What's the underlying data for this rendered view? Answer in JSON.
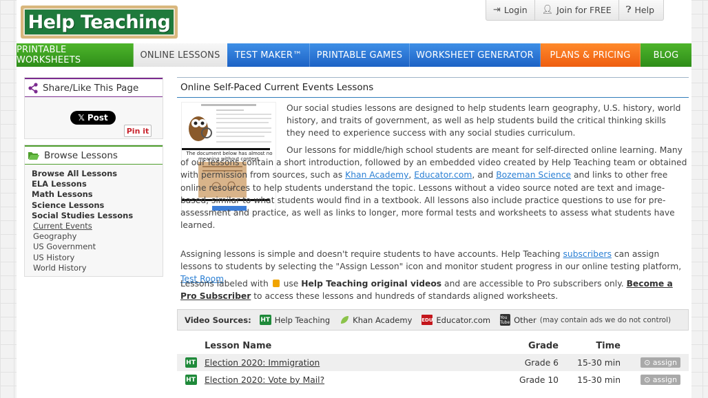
{
  "header": {
    "logo_text": "Help Teaching",
    "top_links": [
      {
        "label": "Login",
        "icon": "login-icon"
      },
      {
        "label": "Join for FREE",
        "icon": "person-icon"
      },
      {
        "label": "Help",
        "icon": "question-icon"
      }
    ]
  },
  "nav": [
    {
      "label": "PRINTABLE WORKSHEETS",
      "color": "#3a9e22"
    },
    {
      "label": "ONLINE LESSONS",
      "color": "#eeeeee"
    },
    {
      "label": "TEST MAKER™",
      "color": "#2a74d6"
    },
    {
      "label": "PRINTABLE GAMES",
      "color": "#2a74d6"
    },
    {
      "label": "WORKSHEET GENERATOR",
      "color": "#2a74d6"
    },
    {
      "label": "PLANS & PRICING",
      "color": "#f26f1d"
    },
    {
      "label": "BLOG",
      "color": "#3a9e22"
    }
  ],
  "sidebar": {
    "share_title": "Share/Like This Page",
    "tweet_label": "Post",
    "pin_label": "Pin it",
    "browse_title": "Browse Lessons",
    "categories": [
      "Browse All Lessons",
      "ELA Lessons",
      "Math Lessons",
      "Science Lessons",
      "Social Studies Lessons"
    ],
    "subcategories": [
      "Current Events",
      "Geography",
      "US Government",
      "US History",
      "World History"
    ]
  },
  "main": {
    "title": "Online Self-Paced Current Events Lessons",
    "thumb_text": "The document below has almost no meaning without context.",
    "p1": "Our social studies lessons are designed to help students learn geography, U.S. history, world history, and traits of government, as well as help students build the critical thinking skills they need to experience success with any social studies curriculum.",
    "p2_a": "Our lessons for middle/high school students are meant for self-directed online learning. Many of our lessons contain a short introduction, followed by an embedded video created by Help Teaching team or obtained with permission from sources, such as ",
    "link_khan": "Khan Academy",
    "sep1": ", ",
    "link_educator": "Educator.com",
    "sep2": ", and ",
    "link_bozeman": "Bozeman Science",
    "p2_b": " and links to other free online resources to help students understand the topic. Lessons without a video source noted are text and image-based, similar to what students would find in a textbook. All lessons also include practice questions to use for pre-assessment and practice, as well as links to longer, more formal tests and worksheets to assess what students have learned.",
    "p3_a": "Assigning lessons is simple and doesn't require students to have accounts. Help Teaching ",
    "link_subscribers": "subscribers",
    "p3_b": " can assign lessons to students by selecting the \"Assign Lesson\" icon and monitor student progress in our online testing platform, ",
    "link_testroom": "Test Room",
    "p3_c": ".",
    "p4_a": "Lessons labeled with ",
    "p4_b": " use ",
    "p4_bold": "Help Teaching original videos",
    "p4_c": " and are accessible to Pro subscribers only. ",
    "p4_link": "Become a Pro Subscriber",
    "p4_d": " to access these lessons and hundreds of standards aligned worksheets."
  },
  "video_sources": {
    "label": "Video Sources:",
    "items": [
      "Help Teaching",
      "Khan Academy",
      "Educator.com",
      "Other"
    ],
    "other_note": "(may contain ads we do not control)",
    "ht_badge": "HT",
    "edu_badge": "EDU",
    "yt_badge": "You Tube"
  },
  "table": {
    "headers": {
      "name": "Lesson Name",
      "grade": "Grade",
      "time": "Time"
    },
    "rows": [
      {
        "name": "Election 2020: Immigration",
        "grade": "Grade 6",
        "time": "15-30 min",
        "action": "assign"
      },
      {
        "name": "Election 2020: Vote by Mail?",
        "grade": "Grade 10",
        "time": "15-30 min",
        "action": "assign"
      }
    ]
  }
}
